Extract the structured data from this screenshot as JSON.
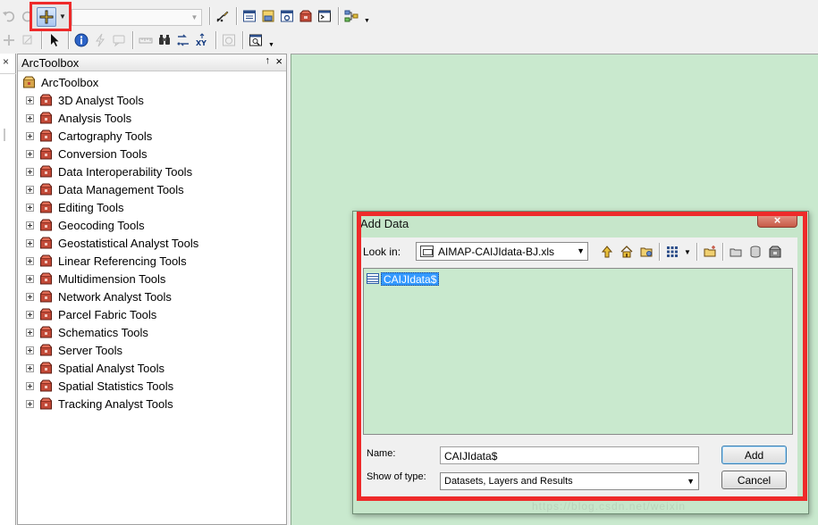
{
  "toolbox": {
    "title": "ArcToolbox",
    "root": "ArcToolbox",
    "pin_glyph": "↑",
    "close_glyph": "×",
    "items": [
      "3D Analyst Tools",
      "Analysis Tools",
      "Cartography Tools",
      "Conversion Tools",
      "Data Interoperability Tools",
      "Data Management Tools",
      "Editing Tools",
      "Geocoding Tools",
      "Geostatistical Analyst Tools",
      "Linear Referencing Tools",
      "Multidimension Tools",
      "Network Analyst Tools",
      "Parcel Fabric Tools",
      "Schematics Tools",
      "Server Tools",
      "Spatial Analyst Tools",
      "Spatial Statistics Tools",
      "Tracking Analyst Tools"
    ]
  },
  "left_strip": {
    "close_glyph": "×"
  },
  "dialog": {
    "title": "Add Data",
    "close_glyph": "×",
    "look_in_label": "Look in:",
    "look_in_value": "AIMAP-CAIJIdata-BJ.xls",
    "files": [
      {
        "name": "CAIJIdata$",
        "selected": true
      }
    ],
    "name_label": "Name:",
    "name_value": "CAIJIdata$",
    "type_label": "Show of type:",
    "type_value": "Datasets, Layers and Results",
    "add_label": "Add",
    "cancel_label": "Cancel"
  },
  "watermark": "https://blog.csdn.net/weixin",
  "colors": {
    "highlight": "#ee2a2a",
    "map_background": "#c9e9ce",
    "selection": "#3399ff",
    "toolbox_icon": "#b5412f"
  },
  "icons": {
    "toolbar": [
      "undo-icon",
      "redo-icon",
      "add-data-icon",
      "editor-icon",
      "table-of-contents-icon",
      "catalog-icon",
      "search-window-icon",
      "arctoolbox-icon",
      "python-window-icon",
      "model-builder-icon"
    ],
    "tools": [
      "select-features-icon",
      "select-elements-icon",
      "identify-icon",
      "hyperlink-icon",
      "html-popup-icon",
      "measure-icon",
      "find-icon",
      "find-route-icon",
      "go-to-xy-icon",
      "time-slider-icon",
      "viewer-window-icon"
    ]
  }
}
